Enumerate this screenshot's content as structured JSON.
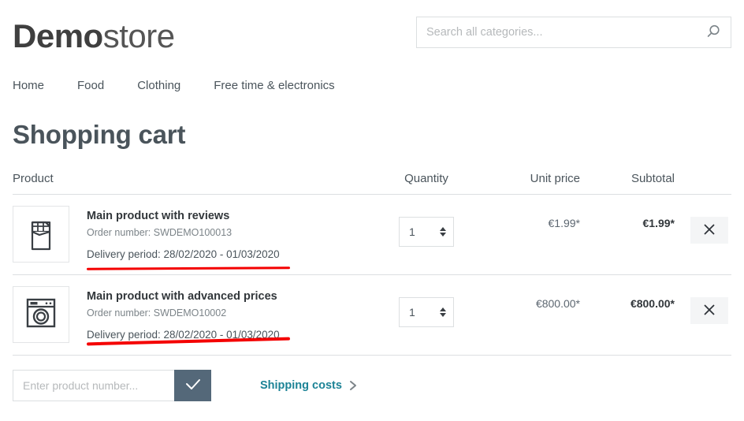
{
  "header": {
    "logo_bold": "Demo",
    "logo_regular": "store",
    "search": {
      "placeholder": "Search all categories...",
      "value": "",
      "icon": "search-icon"
    }
  },
  "nav": {
    "items": [
      {
        "label": "Home"
      },
      {
        "label": "Food"
      },
      {
        "label": "Clothing"
      },
      {
        "label": "Free time & electronics"
      }
    ]
  },
  "main": {
    "title": "Shopping cart",
    "table": {
      "headers": {
        "product": "Product",
        "quantity": "Quantity",
        "unit_price": "Unit price",
        "subtotal": "Subtotal"
      },
      "rows": [
        {
          "image_icon": "chocolate-bar-icon",
          "name": "Main product with reviews",
          "order_number": "Order number: SWDEMO100013",
          "delivery_period": "Delivery period: 28/02/2020 - 01/03/2020",
          "quantity": "1",
          "unit_price": "€1.99*",
          "subtotal": "€1.99*",
          "remove_icon": "close-icon"
        },
        {
          "image_icon": "washing-machine-icon",
          "name": "Main product with advanced prices",
          "order_number": "Order number: SWDEMO10002",
          "delivery_period": "Delivery period: 28/02/2020 - 01/03/2020",
          "quantity": "1",
          "unit_price": "€800.00*",
          "subtotal": "€800.00*",
          "remove_icon": "close-icon"
        }
      ]
    },
    "actions": {
      "add_product_placeholder": "Enter product number...",
      "add_product_value": "",
      "add_product_submit_icon": "check-icon",
      "shipping_costs_label": "Shipping costs",
      "shipping_costs_icon": "chevron-right-icon"
    }
  },
  "colors": {
    "text": "#4a545b",
    "accent_teal": "#1c8396",
    "button_slate": "#546879",
    "annotation_red": "#f40000",
    "border": "#dcdfe1"
  }
}
